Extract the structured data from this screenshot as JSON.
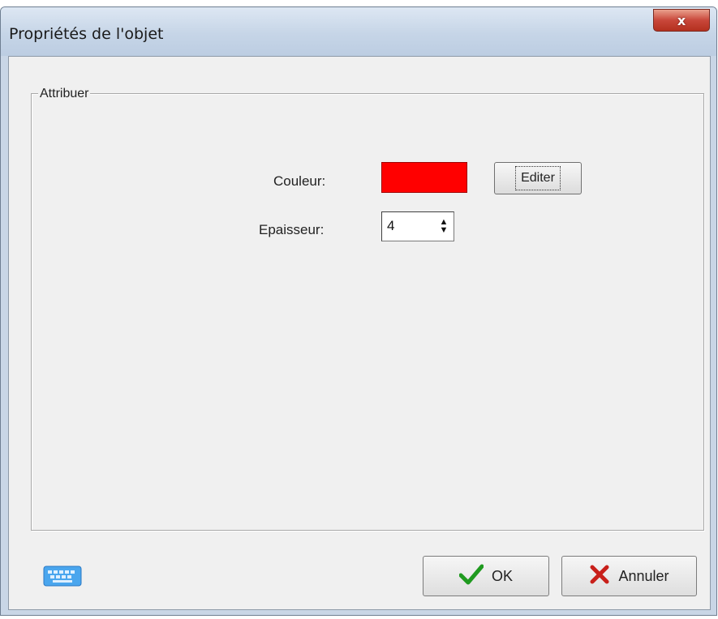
{
  "window": {
    "title": "Propriétés de l'objet",
    "close_glyph": "x"
  },
  "group": {
    "legend": "Attribuer"
  },
  "color_row": {
    "label": "Couleur:",
    "swatch_color": "#ff0000",
    "edit_label": "Editer"
  },
  "thickness_row": {
    "label": "Epaisseur:",
    "value": "4"
  },
  "footer": {
    "keyboard_icon": "keyboard-icon",
    "ok_label": "OK",
    "ok_icon": "checkmark-icon",
    "cancel_label": "Annuler",
    "cancel_icon": "cross-icon"
  }
}
